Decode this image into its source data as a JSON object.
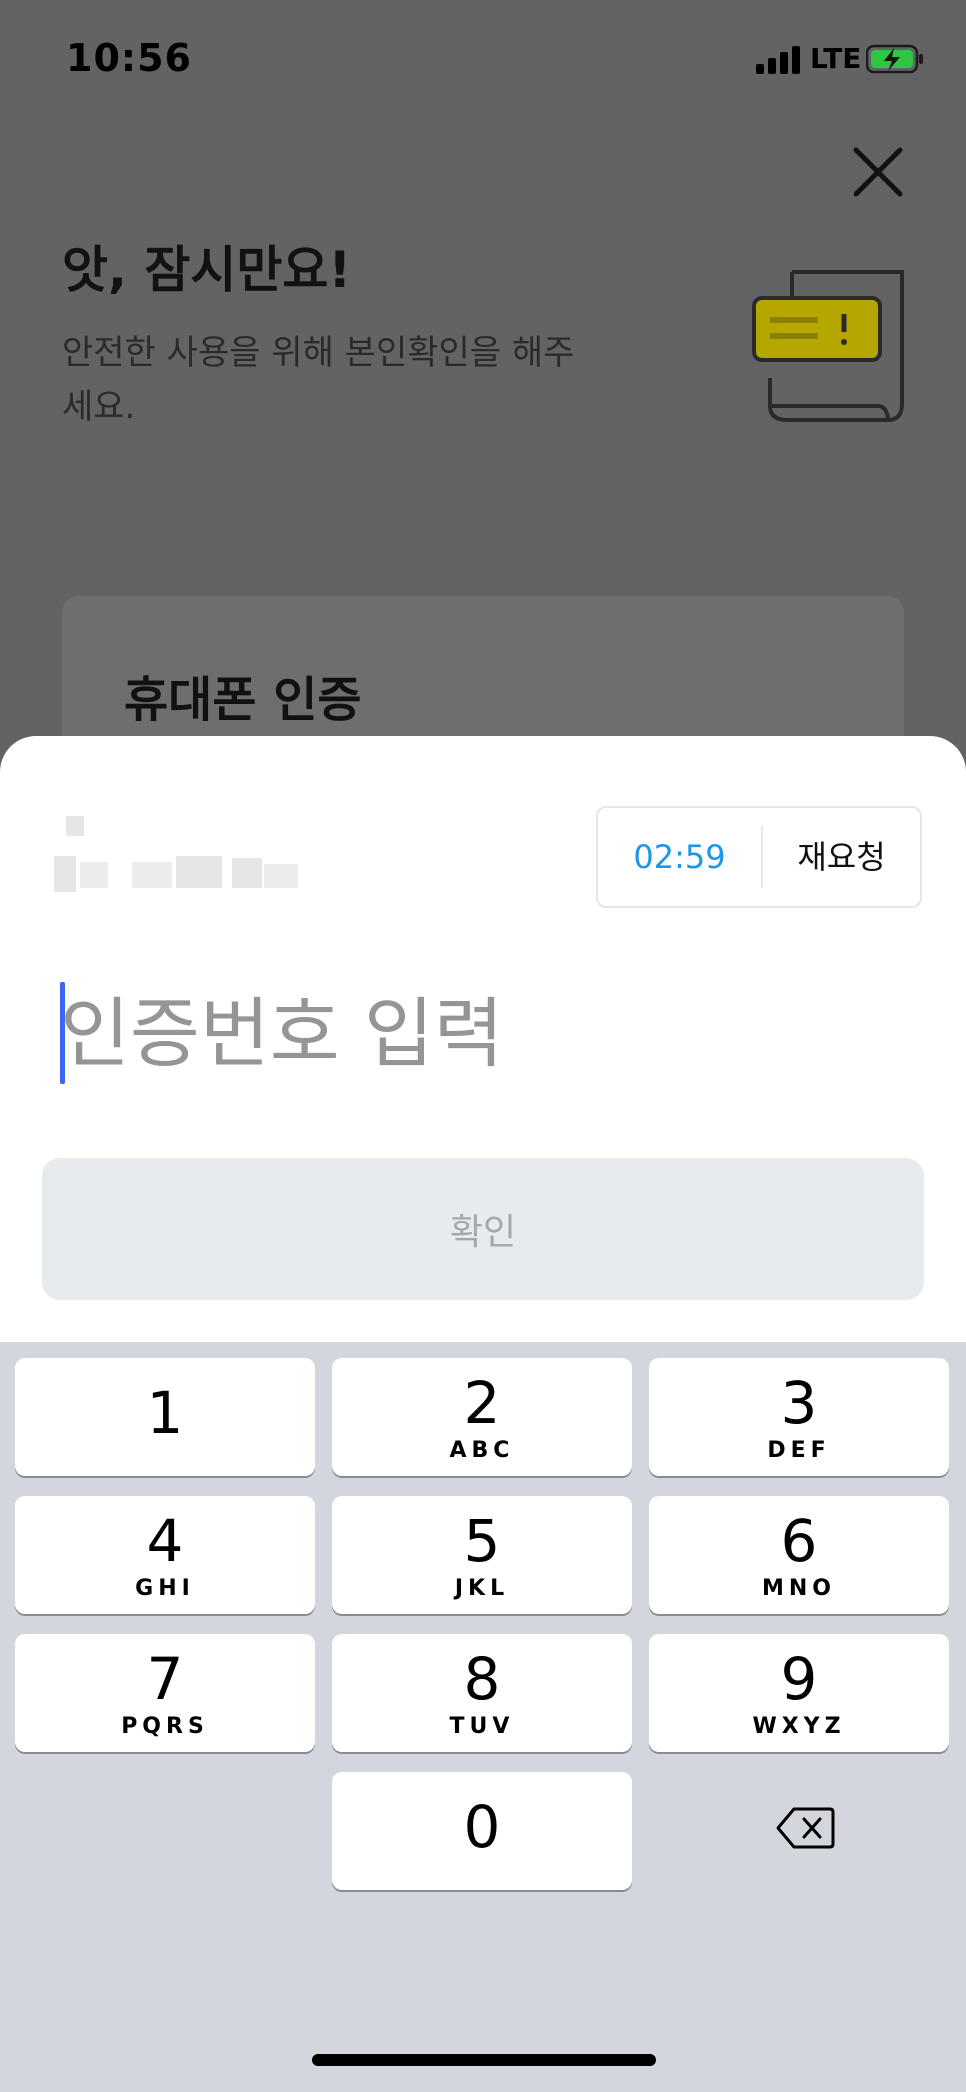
{
  "status": {
    "time": "10:56",
    "network": "LTE"
  },
  "header": {
    "close_icon": "close-icon",
    "title": "앗, 잠시만요!",
    "subtitle": "안전한 사용을 위해 본인확인을 해주세요.",
    "illustration_icon": "warning-document-icon"
  },
  "card": {
    "title": "휴대폰 인증"
  },
  "sheet": {
    "timer": "02:59",
    "resend_label": "재요청",
    "code_placeholder": "인증번호 입력",
    "code_value": "",
    "confirm_label": "확인"
  },
  "keypad": {
    "keys": [
      {
        "num": "1",
        "letters": ""
      },
      {
        "num": "2",
        "letters": "ABC"
      },
      {
        "num": "3",
        "letters": "DEF"
      },
      {
        "num": "4",
        "letters": "GHI"
      },
      {
        "num": "5",
        "letters": "JKL"
      },
      {
        "num": "6",
        "letters": "MNO"
      },
      {
        "num": "7",
        "letters": "PQRS"
      },
      {
        "num": "8",
        "letters": "TUV"
      },
      {
        "num": "9",
        "letters": "WXYZ"
      },
      {
        "num": "0",
        "letters": ""
      }
    ],
    "backspace_icon": "backspace-icon"
  },
  "colors": {
    "overlay": "#636363",
    "timer": "#1a97e8",
    "caret": "#3a66f0",
    "illustration_accent": "#b5a600"
  }
}
